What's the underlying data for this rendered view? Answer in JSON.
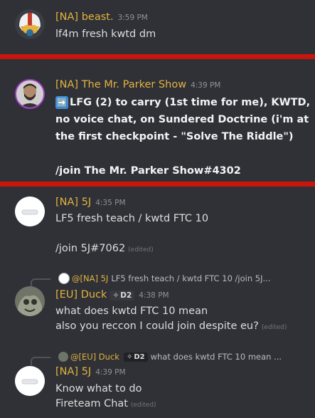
{
  "messages": [
    {
      "username": "[NA] beast.",
      "time": "3:59 PM",
      "lines": [
        "lf4m fresh kwtd dm"
      ]
    },
    {
      "username": "[NA] The Mr. Parker Show",
      "time": "4:39 PM",
      "emoji": "➡️",
      "lines": [
        "LFG (2) to carry (1st time for me), KWTD,",
        "no voice chat, on Sundered Doctrine (i'm at",
        "the first checkpoint - \"Solve The Riddle\")",
        "/join The Mr. Parker Show#4302"
      ]
    },
    {
      "username": "[NA] 5J",
      "time": "4:35 PM",
      "lines": [
        "LF5 fresh teach / kwtd  FTC 10",
        "/join 5J#7062"
      ],
      "edited": "(edited)"
    },
    {
      "reply": {
        "author": "@[NA] 5J",
        "preview": "LF5 fresh teach / kwtd  FTC 10  /join 5J..."
      },
      "username": "[EU] Duck",
      "badge": "D2",
      "time": "4:38 PM",
      "lines": [
        "what does kwtd  FTC 10 mean",
        "also you reccon I could join despite eu?"
      ],
      "edited": "(edited)"
    },
    {
      "reply": {
        "author": "@[EU] Duck",
        "badge": "D2",
        "preview": "what does kwtd  FTC 10 mean ..."
      },
      "username": "[NA] 5J",
      "time": "4:39 PM",
      "lines": [
        "Know what to do",
        "Fireteam Chat"
      ],
      "edited": "(edited)"
    }
  ],
  "icons": {
    "cube": "✧",
    "separator_color": "#c8160c",
    "username_color": "#e3b341"
  }
}
